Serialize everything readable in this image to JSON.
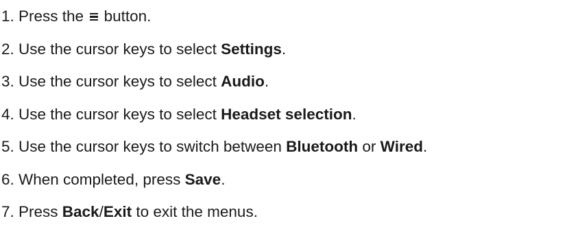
{
  "steps": [
    {
      "number": "1.",
      "parts": [
        "Press the",
        "button."
      ],
      "icon": "menu-icon"
    },
    {
      "number": "2.",
      "parts": [
        "Use the cursor keys to select ",
        "Settings",
        "."
      ]
    },
    {
      "number": "3.",
      "parts": [
        "Use the cursor keys to select ",
        "Audio",
        "."
      ]
    },
    {
      "number": "4.",
      "parts": [
        "Use the cursor keys to select ",
        "Headset selection",
        "."
      ]
    },
    {
      "number": "5.",
      "parts": [
        "Use the cursor keys to switch between ",
        "Bluetooth",
        " or ",
        "Wired",
        "."
      ]
    },
    {
      "number": "6.",
      "parts": [
        "When completed, press ",
        "Save",
        "."
      ]
    },
    {
      "number": "7.",
      "parts": [
        "Press ",
        "Back",
        "/",
        "Exit",
        " to exit the menus."
      ]
    }
  ]
}
